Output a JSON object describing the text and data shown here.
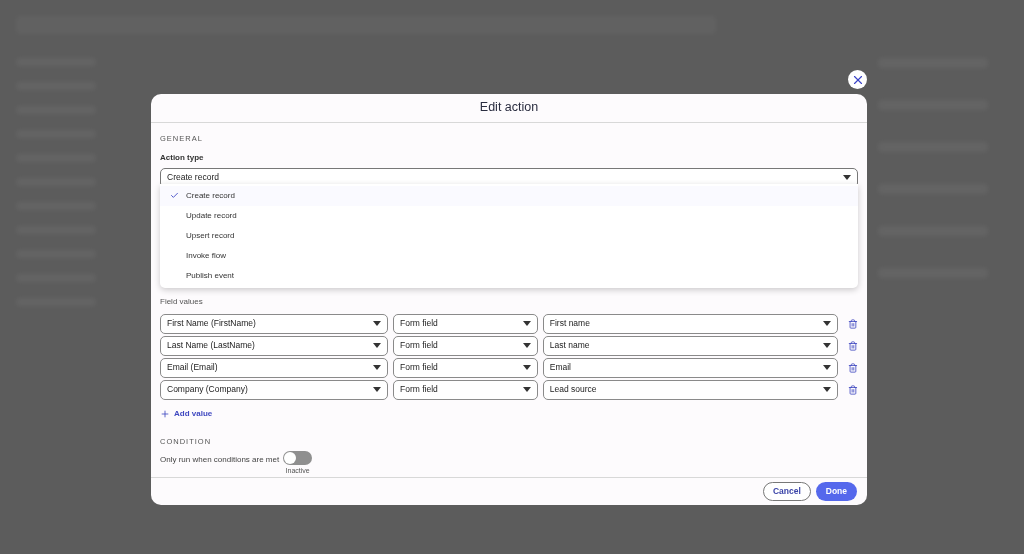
{
  "dialog": {
    "title": "Edit action",
    "general": {
      "heading": "GENERAL",
      "label": "Action type",
      "value": "Create record",
      "options": [
        {
          "label": "Create record",
          "selected": true
        },
        {
          "label": "Update record",
          "selected": false
        },
        {
          "label": "Upsert record",
          "selected": false
        },
        {
          "label": "Invoke flow",
          "selected": false
        },
        {
          "label": "Publish event",
          "selected": false
        }
      ]
    },
    "field_values": {
      "label": "Field values",
      "rows": [
        {
          "target": "First Name (FirstName)",
          "source": "Form field",
          "value": "First name"
        },
        {
          "target": "Last Name (LastName)",
          "source": "Form field",
          "value": "Last name"
        },
        {
          "target": "Email (Email)",
          "source": "Form field",
          "value": "Email"
        },
        {
          "target": "Company (Company)",
          "source": "Form field",
          "value": "Lead source"
        }
      ],
      "add": "Add value"
    },
    "condition": {
      "heading": "CONDITION",
      "label": "Only run when conditions are met",
      "on": false,
      "state": "Inactive"
    },
    "buttons": [
      {
        "label": "Cancel",
        "kind": "secondary"
      },
      {
        "label": "Done",
        "kind": "primary"
      }
    ]
  }
}
